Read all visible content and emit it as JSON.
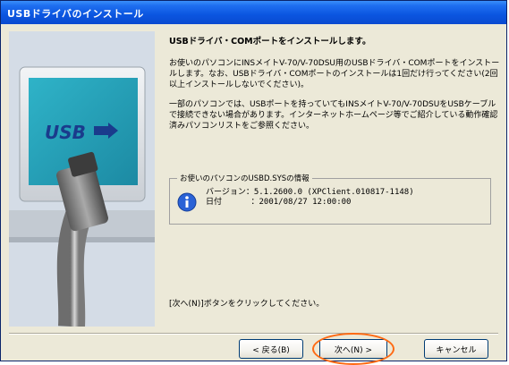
{
  "window": {
    "title": "USBドライバのインストール"
  },
  "artwork": {
    "logo_text": "USB"
  },
  "main": {
    "heading": "USBドライバ・COMポートをインストールします。",
    "paragraph1": "お使いのパソコンにINSメイトV-70/V-70DSU用のUSBドライバ・COMポートをインストールします。なお、USBドライバ・COMポートのインストールは1回だけ行ってください(2回以上インストールしないでください)。",
    "paragraph2": "一部のパソコンでは、USBポートを持っていてもINSメイトV-70/V-70DSUをUSBケーブルで接続できない場合があります。インターネットホームページ等でご紹介している動作確認済みパソコンリストをご参照ください。",
    "info_group": {
      "label": "お使いのパソコンのUSBD.SYSの情報",
      "version_line": "バージョン：5.1.2600.0 (XPClient.010817-1148)",
      "date_line": "日付      ：2001/08/27 12:00:00"
    },
    "instruction": "[次へ(N)]ボタンをクリックしてください。"
  },
  "buttons": {
    "back": "< 戻る(B)",
    "next": "次へ(N) >",
    "cancel": "キャンセル"
  },
  "colors": {
    "titlebar": "#0b55e0",
    "highlight": "#ff6a13",
    "dialog_bg": "#ece9d8"
  }
}
